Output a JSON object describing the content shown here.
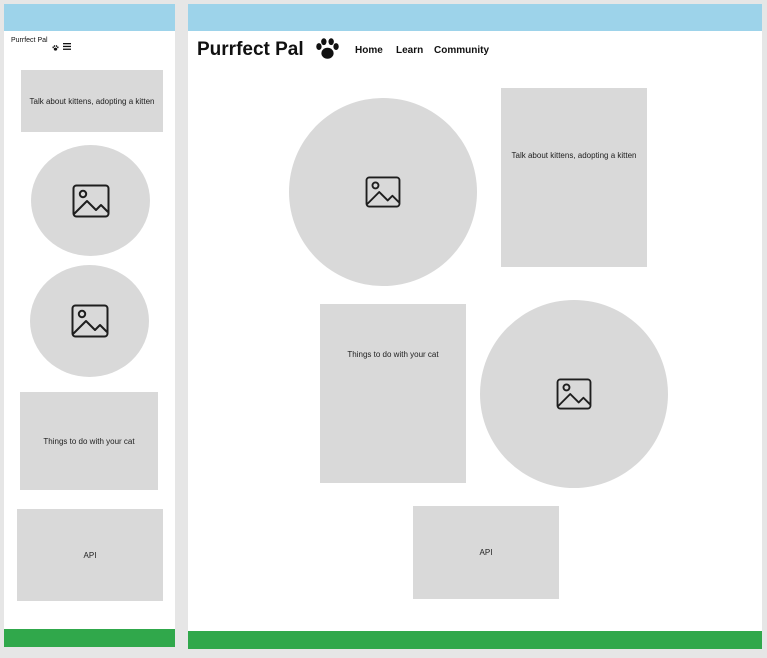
{
  "mobile": {
    "logo_text": "Purrfect Pal",
    "card_kittens": "Talk about kittens, adopting a kitten",
    "card_things": "Things to do with your cat",
    "card_api": "API"
  },
  "desktop": {
    "logo_text": "Purrfect Pal",
    "nav": [
      "Home",
      "Learn",
      "Community"
    ],
    "card_kittens": "Talk about kittens, adopting a kitten",
    "card_things": "Things to do with your cat",
    "card_api": "API"
  },
  "colors": {
    "header": "#9dd3ea",
    "footer": "#30a84b",
    "placeholder": "#d9d9d9"
  },
  "icons": [
    "paw-icon",
    "hamburger-menu-icon",
    "image-placeholder-icon"
  ]
}
